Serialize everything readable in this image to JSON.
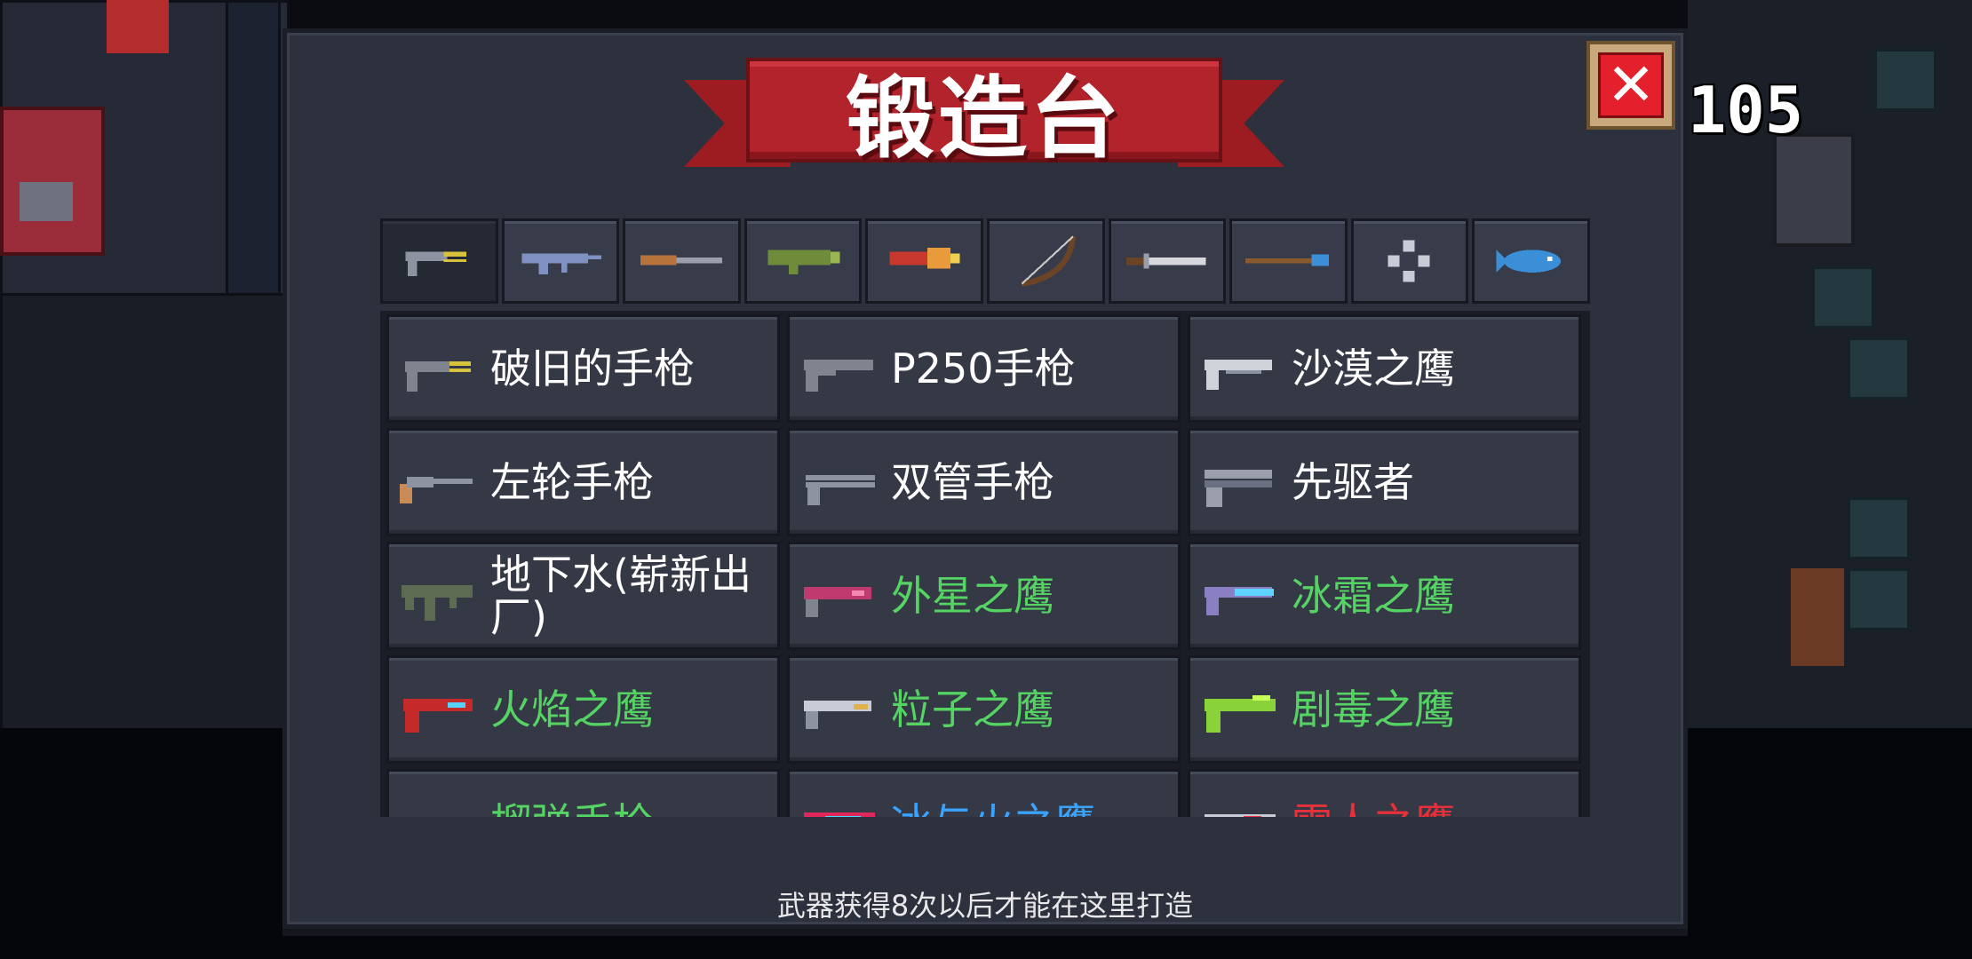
{
  "title": "锻造台",
  "gem_count": "105",
  "hint": "武器获得8次以后才能在这里打造",
  "colors": {
    "common": "#ffffff",
    "uncommon": "#55d464",
    "rare": "#3aa3ff",
    "legendary": "#e8303a"
  },
  "tabs": [
    {
      "icon": "pistol-icon",
      "active": true
    },
    {
      "icon": "rifle-icon",
      "active": false
    },
    {
      "icon": "shotgun-icon",
      "active": false
    },
    {
      "icon": "rocket-launcher-icon",
      "active": false
    },
    {
      "icon": "flamethrower-icon",
      "active": false
    },
    {
      "icon": "bow-icon",
      "active": false
    },
    {
      "icon": "sword-icon",
      "active": false
    },
    {
      "icon": "spear-icon",
      "active": false
    },
    {
      "icon": "crosshair-icon",
      "active": false
    },
    {
      "icon": "fish-icon",
      "active": false
    }
  ],
  "weapons": [
    {
      "name": "破旧的手枪",
      "rarity": "common",
      "icon": "old-pistol-icon"
    },
    {
      "name": "P250手枪",
      "rarity": "common",
      "icon": "p250-pistol-icon"
    },
    {
      "name": "沙漠之鹰",
      "rarity": "common",
      "icon": "desert-eagle-icon"
    },
    {
      "name": "左轮手枪",
      "rarity": "common",
      "icon": "revolver-icon"
    },
    {
      "name": "双管手枪",
      "rarity": "common",
      "icon": "double-barrel-pistol-icon"
    },
    {
      "name": "先驱者",
      "rarity": "common",
      "icon": "pioneer-icon"
    },
    {
      "name": "地下水(崭新出厂)",
      "rarity": "common",
      "icon": "underground-water-icon"
    },
    {
      "name": "外星之鹰",
      "rarity": "uncommon",
      "icon": "alien-eagle-icon"
    },
    {
      "name": "冰霜之鹰",
      "rarity": "uncommon",
      "icon": "frost-eagle-icon"
    },
    {
      "name": "火焰之鹰",
      "rarity": "uncommon",
      "icon": "flame-eagle-icon"
    },
    {
      "name": "粒子之鹰",
      "rarity": "uncommon",
      "icon": "particle-eagle-icon"
    },
    {
      "name": "剧毒之鹰",
      "rarity": "uncommon",
      "icon": "toxic-eagle-icon"
    },
    {
      "name": "榴弹手枪",
      "rarity": "uncommon",
      "icon": "grenade-pistol-icon"
    },
    {
      "name": "冰与火之鹰",
      "rarity": "rare",
      "icon": "ice-fire-eagle-icon"
    },
    {
      "name": "雷人之鹰",
      "rarity": "legendary",
      "icon": "thunder-eagle-icon"
    }
  ]
}
